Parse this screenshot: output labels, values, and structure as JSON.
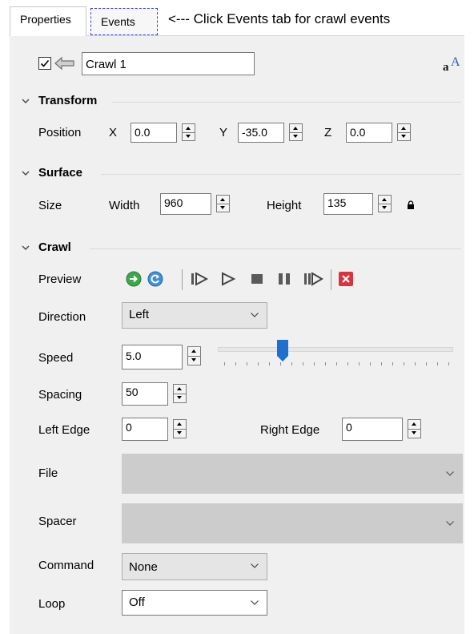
{
  "tabs": [
    {
      "label": "Properties",
      "active": true
    },
    {
      "label": "Events",
      "active": false
    }
  ],
  "hint": "<--- Click Events tab for crawl events",
  "name_row": {
    "enabled_checked": true,
    "name_value": "Crawl 1",
    "font_icon": "font-size-icon"
  },
  "sections": {
    "transform": {
      "title": "Transform",
      "position_label": "Position",
      "x_label": "X",
      "x_value": "0.0",
      "y_label": "Y",
      "y_value": "-35.0",
      "z_label": "Z",
      "z_value": "0.0"
    },
    "surface": {
      "title": "Surface",
      "size_label": "Size",
      "width_label": "Width",
      "width_value": "960",
      "height_label": "Height",
      "height_value": "135",
      "lock_icon": "lock-icon"
    },
    "crawl": {
      "title": "Crawl",
      "preview_label": "Preview",
      "preview_buttons": [
        "go-icon",
        "refresh-icon",
        "step-forward-icon",
        "play-icon",
        "stop-icon",
        "pause-icon",
        "step-back-icon",
        "close-red-icon"
      ],
      "direction_label": "Direction",
      "direction_value": "Left",
      "speed_label": "Speed",
      "speed_value": "5.0",
      "speed_slider_fraction": 0.26,
      "spacing_label": "Spacing",
      "spacing_value": "50",
      "left_edge_label": "Left Edge",
      "left_edge_value": "0",
      "right_edge_label": "Right Edge",
      "right_edge_value": "0",
      "file_label": "File",
      "file_value": "",
      "spacer_label": "Spacer",
      "spacer_value": "",
      "command_label": "Command",
      "command_value": "None",
      "loop_label": "Loop",
      "loop_value": "Off"
    }
  },
  "colors": {
    "panel_bg": "#f0f0f0",
    "slider_thumb": "#1e6fd0",
    "go_green": "#3aa84b",
    "refresh_blue": "#3f8fd8",
    "close_red": "#d9333f",
    "events_dash": "#3b3bd6"
  }
}
